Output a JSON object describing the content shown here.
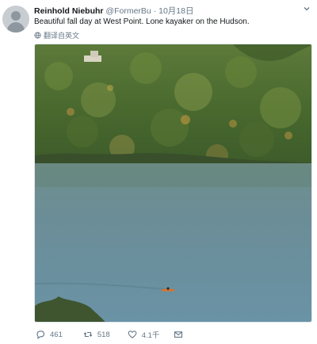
{
  "tweet": {
    "author_name": "Reinhold Niebuhr",
    "handle": "@FormerBu",
    "separator": "·",
    "timestamp": "10月18日",
    "text": "Beautiful fall day at West Point. Lone kayaker on the Hudson.",
    "translate_label": "翻译自英文"
  },
  "actions": {
    "reply_count": "461",
    "retweet_count": "518",
    "like_count": "4.1千"
  },
  "icons": {
    "avatar": "default-avatar",
    "menu": "chevron-down-icon",
    "translate": "globe-icon",
    "reply": "reply-icon",
    "retweet": "retweet-icon",
    "like": "heart-icon",
    "message": "envelope-icon"
  },
  "colors": {
    "secondary_text": "#657786",
    "primary_text": "#14171a"
  }
}
